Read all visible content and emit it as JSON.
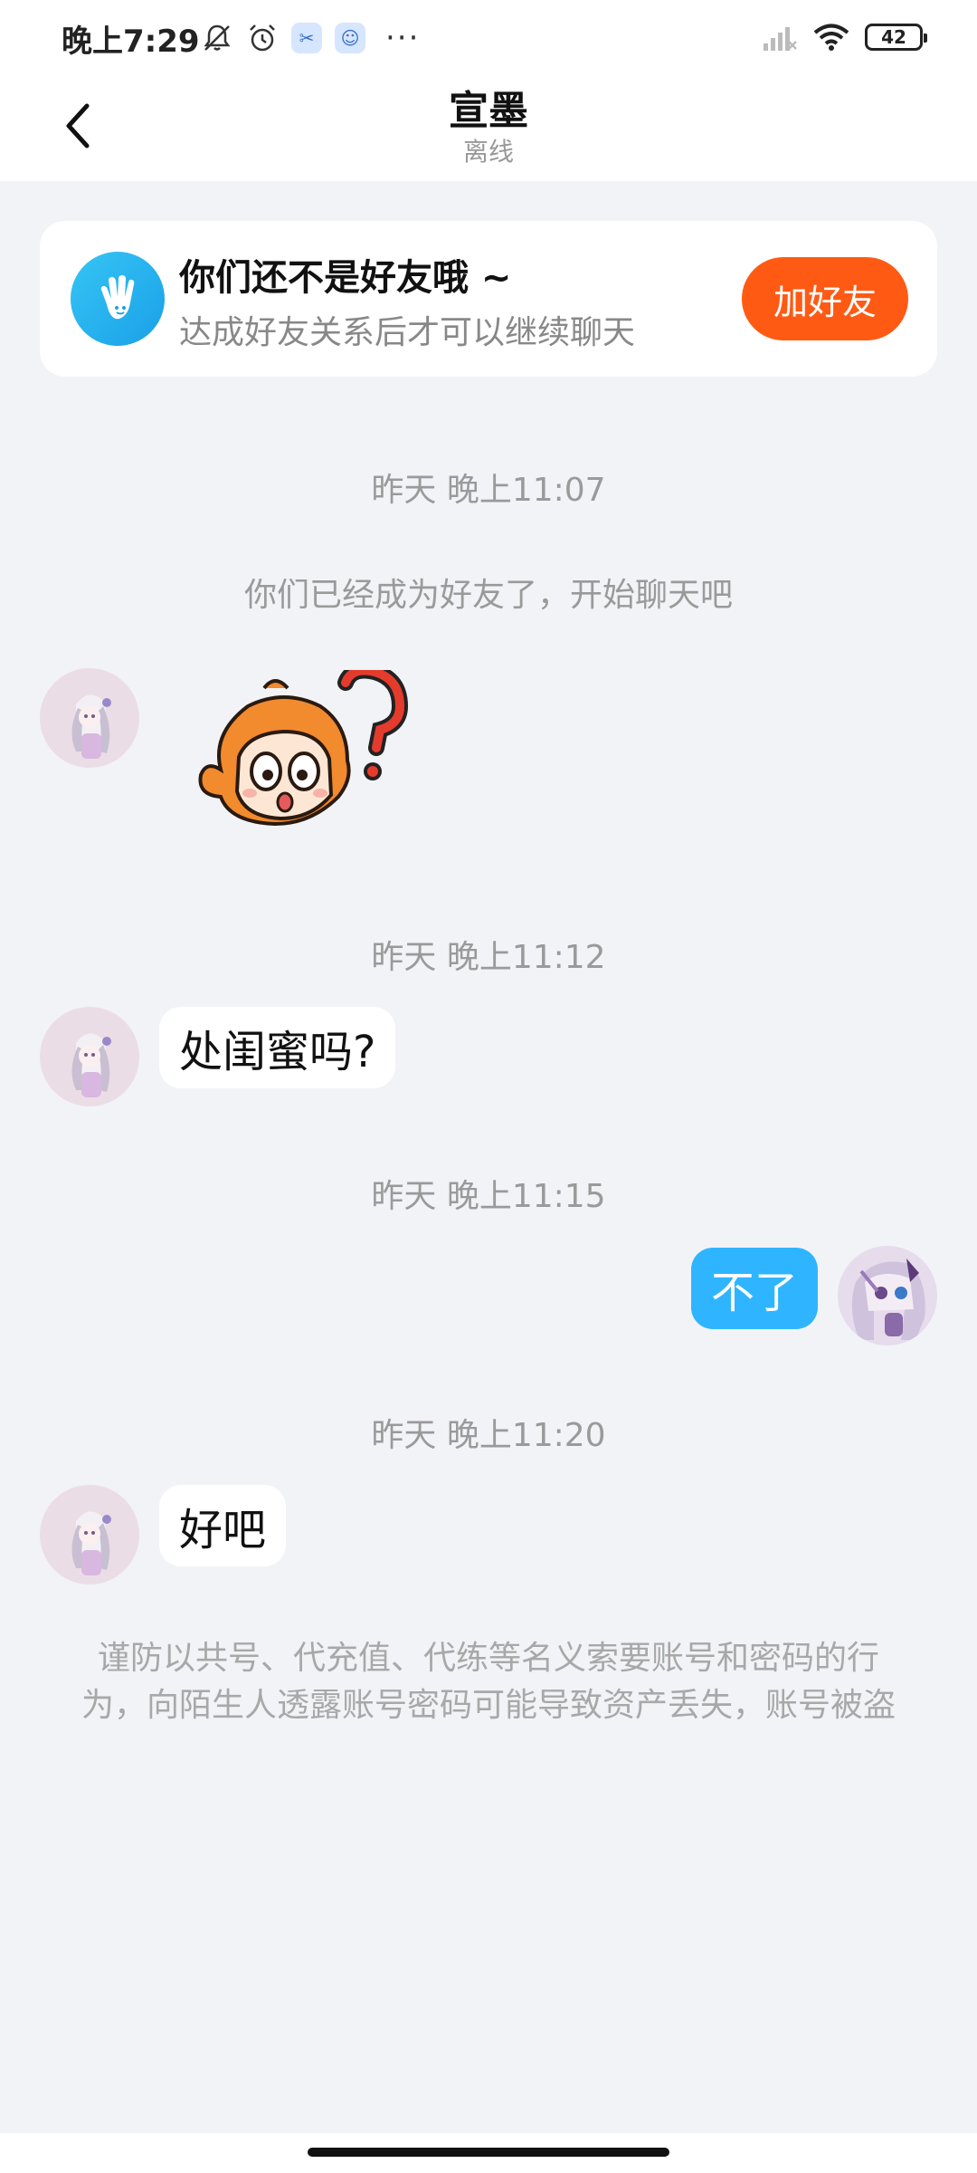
{
  "status_bar": {
    "time": "晚上7:29",
    "battery": "42",
    "more": "···",
    "icons": [
      "mute-icon",
      "alarm-icon",
      "app-icon-1",
      "app-icon-2",
      "signal-icon",
      "wifi-icon",
      "battery-icon"
    ]
  },
  "header": {
    "title": "宣墨",
    "status": "离线"
  },
  "friend_card": {
    "title": "你们还不是好友哦 ~",
    "subtitle": "达成好友关系后才可以继续聊天",
    "button_label": "加好友"
  },
  "messages": [
    {
      "type": "timestamp",
      "text": "昨天 晚上11:07"
    },
    {
      "type": "system",
      "text": "你们已经成为好友了，开始聊天吧"
    },
    {
      "type": "sticker",
      "from": "them",
      "description_icon": "confused-sticker"
    },
    {
      "type": "timestamp",
      "text": "昨天 晚上11:12"
    },
    {
      "type": "text",
      "from": "them",
      "text": "处闺蜜吗?"
    },
    {
      "type": "timestamp",
      "text": "昨天 晚上11:15"
    },
    {
      "type": "text",
      "from": "me",
      "text": "不了"
    },
    {
      "type": "timestamp",
      "text": "昨天 晚上11:20"
    },
    {
      "type": "text",
      "from": "them",
      "text": "好吧"
    }
  ],
  "warning": "谨防以共号、代充值、代练等名义索要账号和密码的行为，向陌生人透露账号密码可能导致资产丢失，账号被盗",
  "colors": {
    "accent_orange": "#ff5a14",
    "bubble_out": "#2fb5ff",
    "background": "#f2f3f7"
  }
}
